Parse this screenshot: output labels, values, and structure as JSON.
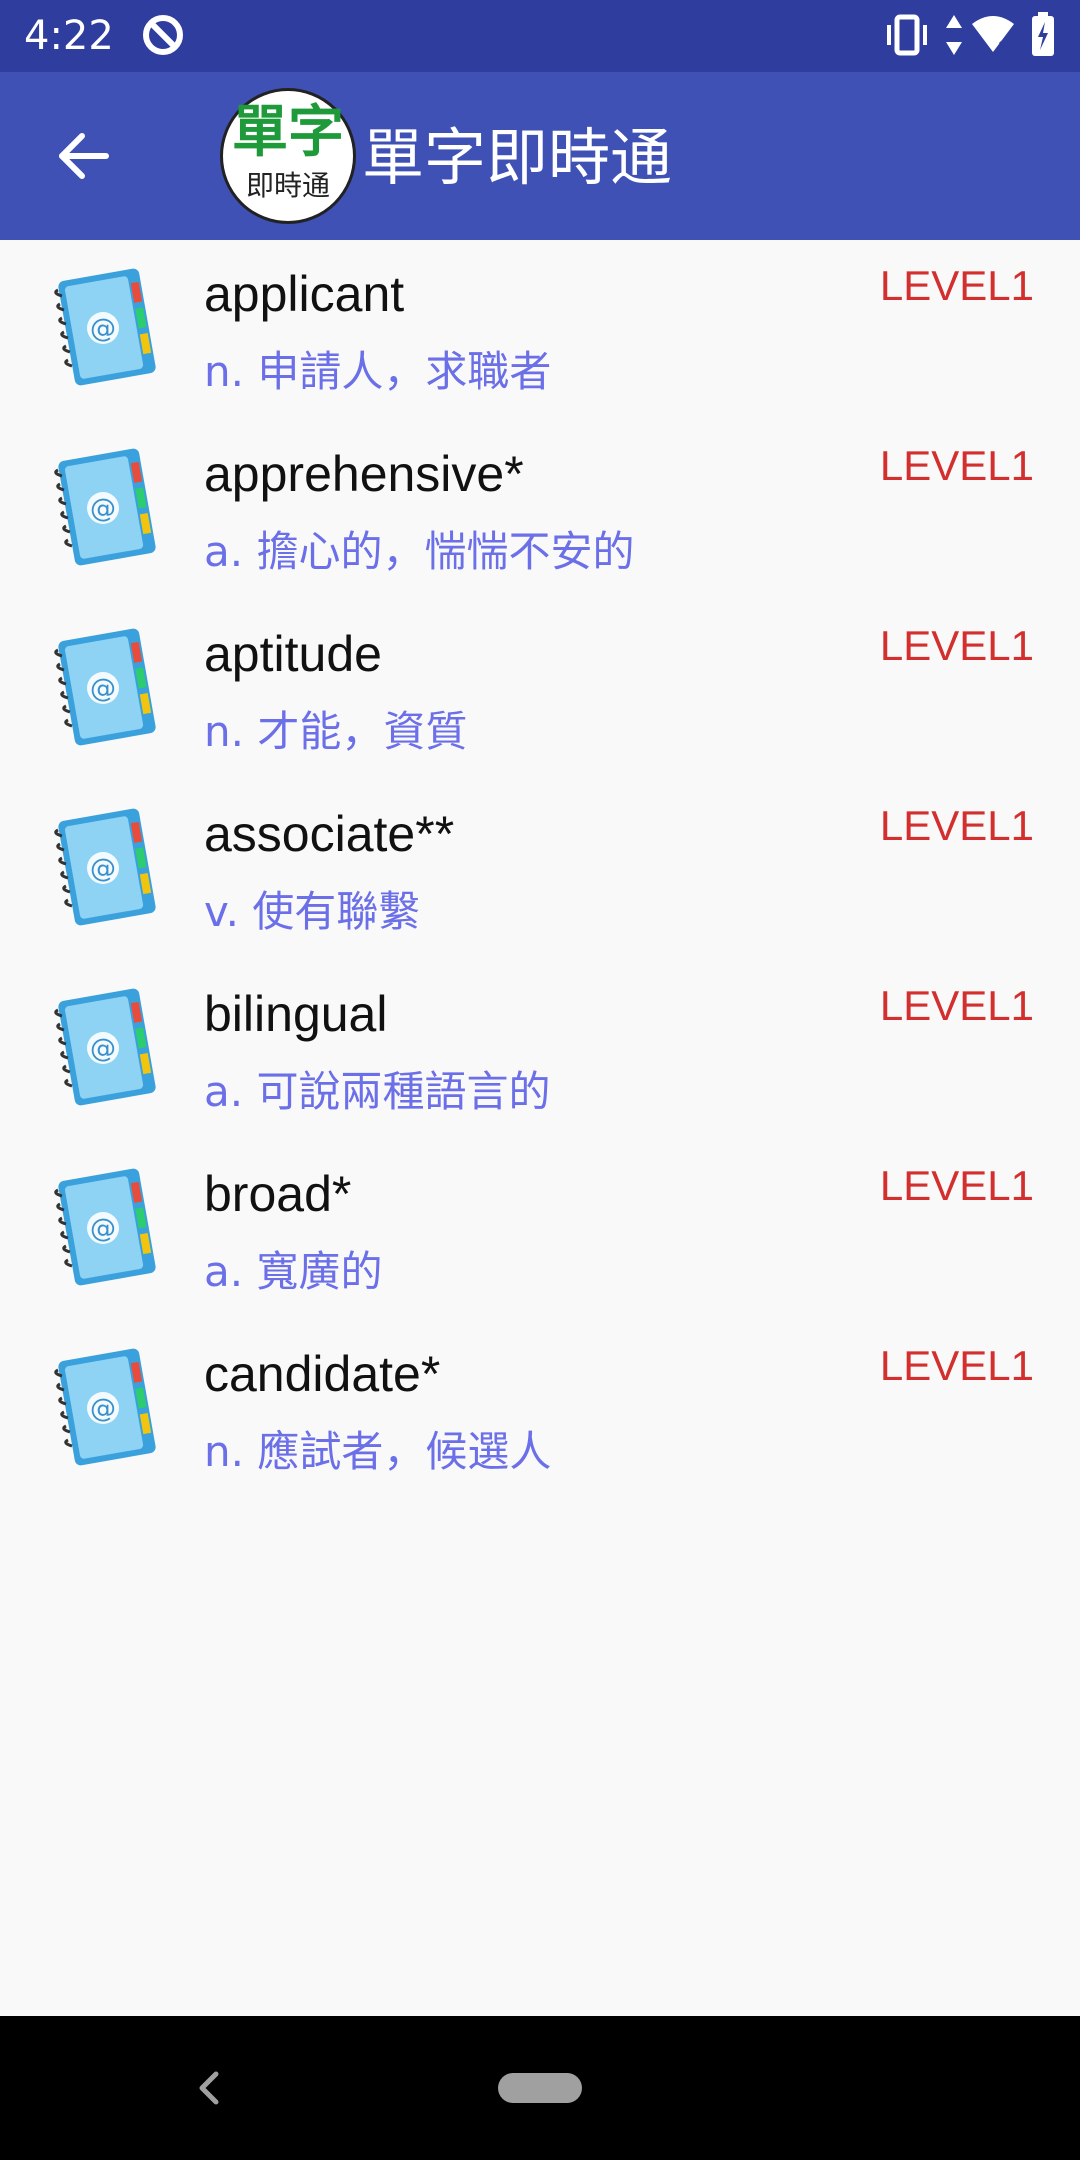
{
  "status_bar": {
    "time": "4:22",
    "icons": [
      "notification-q-icon",
      "vibrate-icon",
      "data-arrows-icon",
      "wifi-icon",
      "battery-icon"
    ]
  },
  "app_bar": {
    "logo_main": "單字",
    "logo_sub": "即時通",
    "title": "單字即時通",
    "back_icon": "arrow-back-icon"
  },
  "words": [
    {
      "word": "applicant",
      "definition": "n. 申請人，求職者",
      "level": "LEVEL1"
    },
    {
      "word": "apprehensive*",
      "definition": "a. 擔心的，惴惴不安的",
      "level": "LEVEL1"
    },
    {
      "word": "aptitude",
      "definition": "n. 才能，資質",
      "level": "LEVEL1"
    },
    {
      "word": "associate**",
      "definition": "v. 使有聯繫",
      "level": "LEVEL1"
    },
    {
      "word": "bilingual",
      "definition": "a. 可說兩種語言的",
      "level": "LEVEL1"
    },
    {
      "word": "broad*",
      "definition": "a. 寬廣的",
      "level": "LEVEL1"
    },
    {
      "word": "candidate*",
      "definition": "n. 應試者，候選人",
      "level": "LEVEL1"
    }
  ],
  "colors": {
    "status_bar": "#2e3d9e",
    "app_bar": "#3f51b5",
    "definition": "#6b6fe8",
    "level": "#d32f2f",
    "logo_green": "#1f9a3a"
  }
}
